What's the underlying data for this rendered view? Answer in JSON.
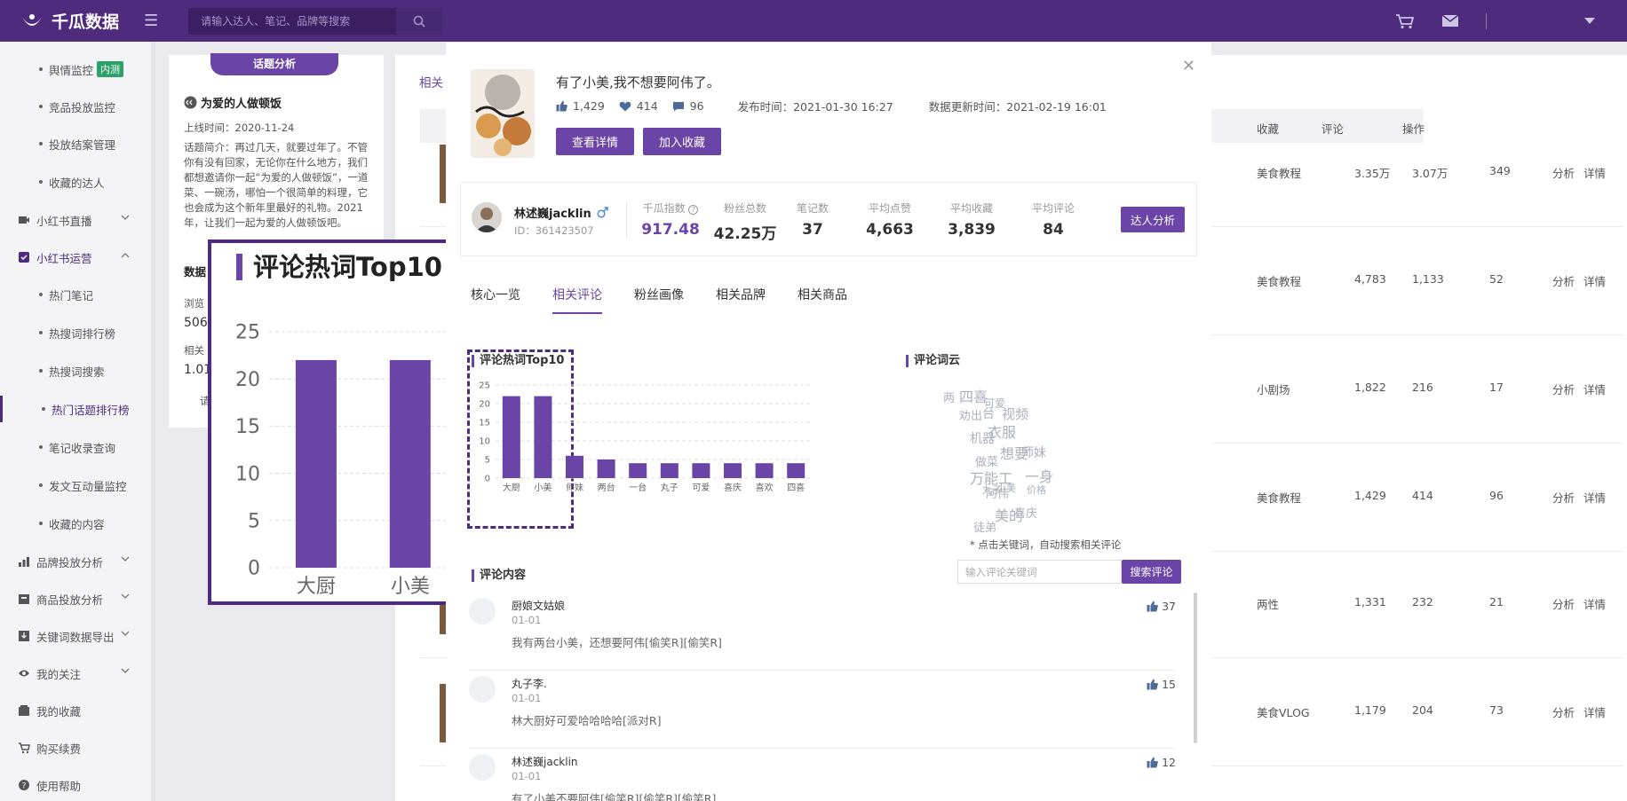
{
  "app": {
    "name": "千瓜数据"
  },
  "search": {
    "placeholder": "请输入达人、笔记、品牌等搜索"
  },
  "sidebar": {
    "items": [
      {
        "label": "舆情监控",
        "badge": "内测"
      },
      {
        "label": "竞品投放监控"
      },
      {
        "label": "投放结案管理"
      },
      {
        "label": "收藏的达人"
      },
      {
        "label": "小红书直播"
      },
      {
        "label": "小红书运营"
      },
      {
        "label": "热门笔记"
      },
      {
        "label": "热搜词排行榜"
      },
      {
        "label": "热搜词搜索"
      },
      {
        "label": "热门话题排行榜"
      },
      {
        "label": "笔记收录查询"
      },
      {
        "label": "发文互动量监控"
      },
      {
        "label": "收藏的内容"
      },
      {
        "label": "品牌投放分析"
      },
      {
        "label": "商品投放分析"
      },
      {
        "label": "关键词数据导出"
      },
      {
        "label": "我的关注"
      },
      {
        "label": "我的收藏"
      },
      {
        "label": "购买续费"
      },
      {
        "label": "使用帮助"
      }
    ]
  },
  "topic": {
    "pill": "话题分析",
    "title": "为爱的人做顿饭",
    "online": "上线时间：2020-11-24",
    "intro": "话题简介：再过几天，就要过年了。不管你有没有回家，无论你在什么地方，我们都想邀请你一起“为爱的人做顿饭”，一道菜、一碗汤，哪怕一个很简单的料理，它也会成为这个新年里最好的礼物。2021年，让我们一起为爱的人做顿饭吧。",
    "data_label": "数据",
    "browse_label": "浏览",
    "browse_val": "506",
    "related_label": "相关",
    "related_val": "1.01",
    "more": "请"
  },
  "bg_table": {
    "tab": "相关",
    "headers": [
      "收藏",
      "评论",
      "操作"
    ],
    "rows": [
      {
        "cat": "美食教程",
        "a": "3.35万",
        "b": "3.07万",
        "c": "349"
      },
      {
        "cat": "美食教程",
        "a": "4,783",
        "b": "1,133",
        "c": "52"
      },
      {
        "cat": "小剧场",
        "a": "1,822",
        "b": "216",
        "c": "17"
      },
      {
        "cat": "美食教程",
        "a": "1,429",
        "b": "414",
        "c": "96"
      },
      {
        "cat": "两性",
        "a": "1,331",
        "b": "232",
        "c": "21"
      },
      {
        "cat": "美食VLOG",
        "a": "1,179",
        "b": "204",
        "c": "73"
      }
    ],
    "action1": "分析",
    "action2": "详情"
  },
  "modal": {
    "title": "有了小美,我不想要阿伟了。",
    "likes": "1,429",
    "collects": "414",
    "comments": "96",
    "publish": "发布时间：2021-01-30 16:27",
    "updated": "数据更新时间：2021-02-19 16:01",
    "btn_detail": "查看详情",
    "btn_fav": "加入收藏",
    "author": {
      "name": "林述巍jacklin",
      "id": "ID：361423507",
      "btn": "达人分析",
      "stats": [
        {
          "label": "千瓜指数",
          "value": "917.48"
        },
        {
          "label": "粉丝总数",
          "value": "42.25万"
        },
        {
          "label": "笔记数",
          "value": "37"
        },
        {
          "label": "平均点赞",
          "value": "4,663"
        },
        {
          "label": "平均收藏",
          "value": "3,839"
        },
        {
          "label": "平均评论",
          "value": "84"
        }
      ]
    },
    "tabs": [
      "核心一览",
      "相关评论",
      "粉丝画像",
      "相关品牌",
      "相关商品"
    ],
    "active_tab": 1,
    "hot_title": "评论热词Top10",
    "cloud_title": "评论词云",
    "hint": "* 点击关键词，自动搜索相关评论",
    "kw_placeholder": "输入评论关键词",
    "kw_btn": "搜索评论",
    "comment_title": "评论内容",
    "comments_list": [
      {
        "name": "厨娘文姑娘",
        "date": "01-01",
        "text": "我有两台小美，还想要阿伟[偷笑R][偷笑R]",
        "likes": "37"
      },
      {
        "name": "丸子李.",
        "date": "01-01",
        "text": "林大厨好可爱哈哈哈哈[派对R]",
        "likes": "15"
      },
      {
        "name": "林述巍jacklin",
        "date": "01-01",
        "text": "有了小美不要阿伟[偷笑R][偷笑R][偷笑R]",
        "likes": "12"
      }
    ]
  },
  "cloud_words": [
    "两",
    "四喜",
    "可爱",
    "视频",
    "劝出",
    "台",
    "衣服",
    "机器",
    "想要",
    "师妹",
    "做菜",
    "一身",
    "万能工",
    "阿伟",
    "丸子",
    "小美",
    "价格",
    "美的",
    "喜庆",
    "徒弟"
  ],
  "zoom": {
    "title": "评论热词Top10"
  },
  "chart_data": {
    "type": "bar",
    "title": "评论热词Top10",
    "categories": [
      "大厨",
      "小美",
      "师妹",
      "两台",
      "一台",
      "丸子",
      "可爱",
      "喜庆",
      "喜欢",
      "四喜"
    ],
    "values": [
      22,
      22,
      6,
      5,
      4,
      4,
      4,
      4,
      4,
      4
    ],
    "ylim": [
      0,
      25
    ],
    "yticks": [
      0,
      5,
      10,
      15,
      20,
      25
    ],
    "grid": true,
    "color": "#6a44a6",
    "zoom_categories": [
      "大厨",
      "小美"
    ]
  },
  "colors": {
    "brand": "#4e2b7c",
    "accent": "#6a44a6",
    "link": "#6f8cd6"
  }
}
